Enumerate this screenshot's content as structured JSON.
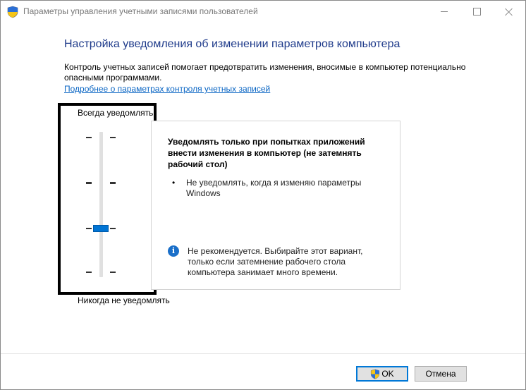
{
  "window": {
    "title": "Параметры управления учетными записями пользователей"
  },
  "main": {
    "heading": "Настройка уведомления об изменении параметров компьютера",
    "description": "Контроль учетных записей помогает предотвратить изменения, вносимые в компьютер потенциально опасными программами.",
    "link": "Подробнее о параметрах контроля учетных записей"
  },
  "slider": {
    "top_label": "Всегда уведомлять",
    "bottom_label": "Никогда не уведомлять",
    "levels": 4,
    "selected_level": 2,
    "selected_level_note": "level counted from bottom, 1-4"
  },
  "panel": {
    "title": "Уведомлять только при попытках приложений внести изменения в компьютер (не затемнять рабочий стол)",
    "bullet": "Не уведомлять, когда я изменяю параметры Windows",
    "info": "Не рекомендуется. Выбирайте этот вариант, только если затемнение рабочего стола компьютера занимает много времени."
  },
  "buttons": {
    "ok": "OK",
    "cancel": "Отмена"
  },
  "colors": {
    "heading": "#1e3a8a",
    "link": "#0b66c4",
    "slider_thumb": "#0074d4",
    "info_icon": "#1a6fc9"
  }
}
